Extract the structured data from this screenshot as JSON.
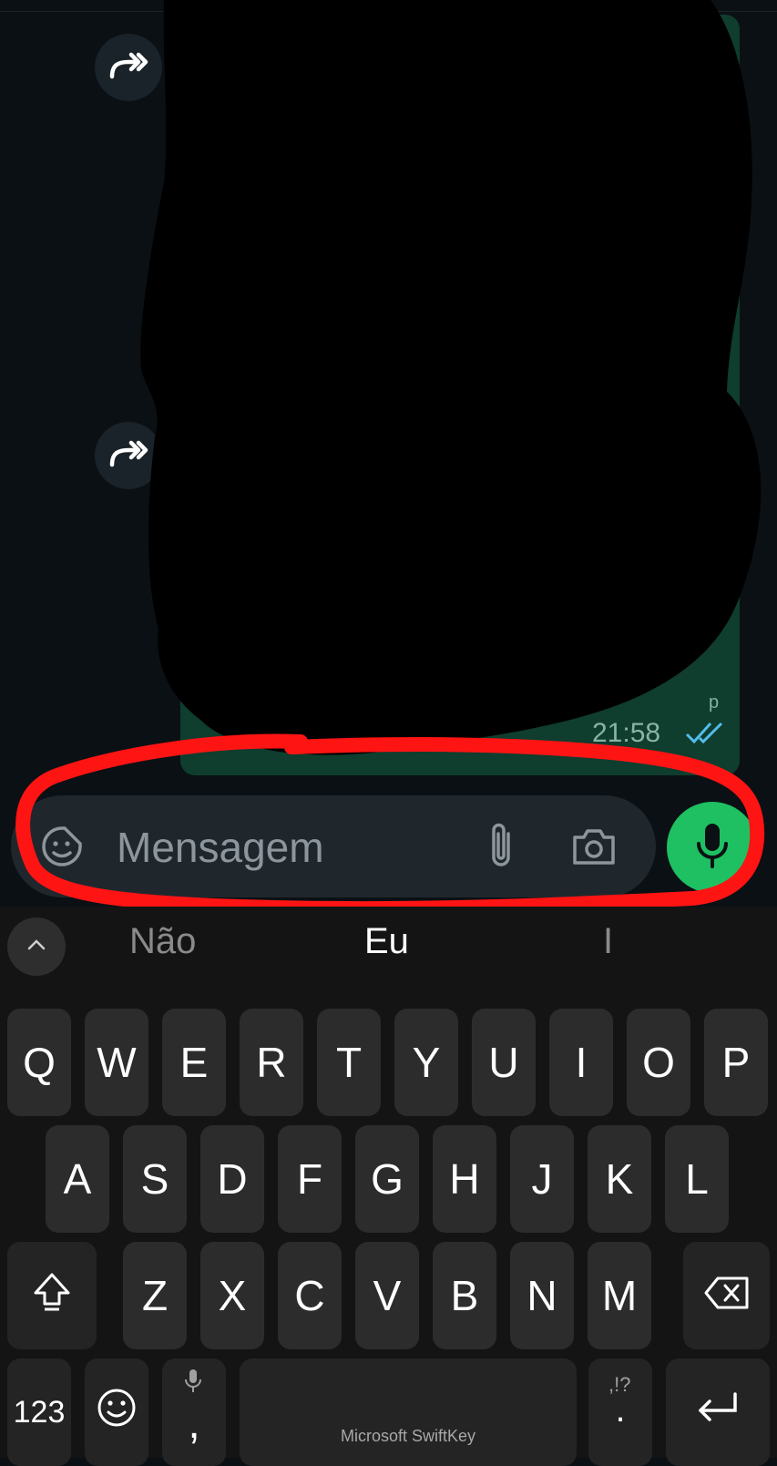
{
  "chat": {
    "forward_icon_1": "forward-arrow-icon",
    "forward_icon_2": "forward-arrow-icon",
    "message_time": "21:58",
    "bubble_fragment": "p",
    "status_icon": "double-check-icon"
  },
  "composer": {
    "emoji_icon": "sticker-emoji-icon",
    "placeholder": "Mensagem",
    "attach_icon": "paperclip-icon",
    "camera_icon": "camera-icon",
    "mic_icon": "microphone-icon",
    "accent": "#1ec062"
  },
  "keyboard": {
    "suggestions": [
      "Não",
      "Eu",
      "I"
    ],
    "row1": [
      "Q",
      "W",
      "E",
      "R",
      "T",
      "Y",
      "U",
      "I",
      "O",
      "P"
    ],
    "row2": [
      "A",
      "S",
      "D",
      "F",
      "G",
      "H",
      "J",
      "K",
      "L"
    ],
    "row3": [
      "Z",
      "X",
      "C",
      "V",
      "B",
      "N",
      "M"
    ],
    "numbers_key": "123",
    "comma_key": ",",
    "period_key": ".",
    "punct_hint": ",!?",
    "space_label": "Microsoft SwiftKey"
  },
  "colors": {
    "background": "#0b1014",
    "keyboard_bg": "#141414",
    "key_bg": "#2c2c2c",
    "annotation_red": "#ff1414"
  }
}
